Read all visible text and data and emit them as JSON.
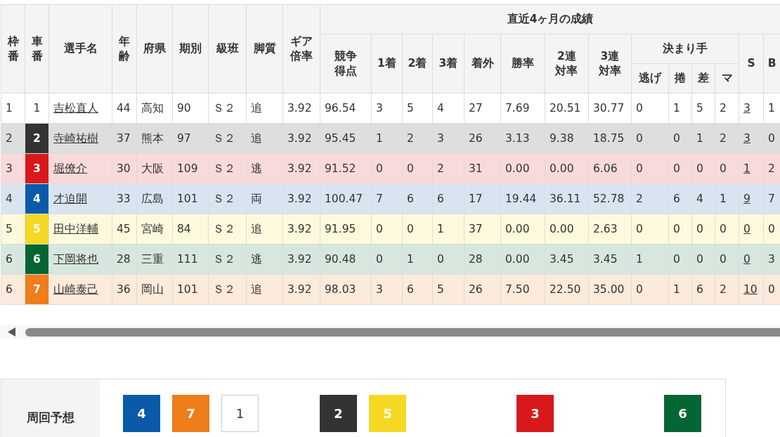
{
  "table": {
    "column_groups": [
      {
        "label": "直近4ヶ月の成績"
      },
      {
        "label": "決まり手"
      }
    ],
    "columns": [
      {
        "label": "枠番"
      },
      {
        "label": "車番"
      },
      {
        "label": "選手名"
      },
      {
        "label": "年齢"
      },
      {
        "label": "府県"
      },
      {
        "label": "期別"
      },
      {
        "label": "級班"
      },
      {
        "label": "脚質"
      },
      {
        "label": "ギア倍率"
      },
      {
        "label": "競争得点"
      },
      {
        "label": "1着"
      },
      {
        "label": "2着"
      },
      {
        "label": "3着"
      },
      {
        "label": "着外"
      },
      {
        "label": "勝率"
      },
      {
        "label": "2連対率"
      },
      {
        "label": "3連対率"
      },
      {
        "label": "逃げ"
      },
      {
        "label": "捲"
      },
      {
        "label": "差"
      },
      {
        "label": "マ"
      },
      {
        "label": "S"
      },
      {
        "label": "B"
      }
    ],
    "rows": [
      {
        "color": "#ffffff",
        "cells": [
          "1",
          "1",
          "吉松直人",
          "44",
          "高知",
          "90",
          "Ｓ２",
          "追",
          "3.92",
          "96.54",
          "3",
          "5",
          "4",
          "27",
          "7.69",
          "20.51",
          "30.77",
          "0",
          "1",
          "5",
          "2",
          "3",
          "1"
        ]
      },
      {
        "color": "#333333",
        "cells": [
          "2",
          "2",
          "寺崎祐樹",
          "37",
          "熊本",
          "97",
          "Ｓ２",
          "追",
          "3.92",
          "95.45",
          "1",
          "2",
          "3",
          "26",
          "3.13",
          "9.38",
          "18.75",
          "0",
          "0",
          "1",
          "2",
          "3",
          "0"
        ]
      },
      {
        "color": "#d9181b",
        "cells": [
          "3",
          "3",
          "堀僚介",
          "30",
          "大阪",
          "109",
          "Ｓ２",
          "逃",
          "3.92",
          "91.52",
          "0",
          "0",
          "2",
          "31",
          "0.00",
          "0.00",
          "6.06",
          "0",
          "0",
          "0",
          "0",
          "1",
          "2"
        ]
      },
      {
        "color": "#0b5aaa",
        "cells": [
          "4",
          "4",
          "才迫開",
          "33",
          "広島",
          "101",
          "Ｓ２",
          "両",
          "3.92",
          "100.47",
          "7",
          "6",
          "6",
          "17",
          "19.44",
          "36.11",
          "52.78",
          "2",
          "6",
          "4",
          "1",
          "9",
          "7"
        ]
      },
      {
        "color": "#f5d823",
        "cells": [
          "5",
          "5",
          "田中洋輔",
          "45",
          "宮崎",
          "84",
          "Ｓ２",
          "追",
          "3.92",
          "91.95",
          "0",
          "0",
          "1",
          "37",
          "0.00",
          "0.00",
          "2.63",
          "0",
          "0",
          "0",
          "0",
          "0",
          "0"
        ]
      },
      {
        "color": "#066633",
        "cells": [
          "6",
          "6",
          "下岡将也",
          "28",
          "三重",
          "111",
          "Ｓ２",
          "逃",
          "3.92",
          "90.48",
          "0",
          "1",
          "0",
          "28",
          "0.00",
          "3.45",
          "3.45",
          "1",
          "0",
          "0",
          "0",
          "0",
          "3"
        ]
      },
      {
        "color": "#ee7d1a",
        "cells": [
          "6",
          "7",
          "山崎泰己",
          "36",
          "岡山",
          "101",
          "Ｓ２",
          "追",
          "3.92",
          "98.03",
          "3",
          "6",
          "5",
          "26",
          "7.50",
          "22.50",
          "35.00",
          "0",
          "1",
          "6",
          "2",
          "10",
          "0"
        ]
      }
    ]
  },
  "lap_forecast": {
    "label": "周回予想",
    "groups": [
      [
        {
          "number": "4",
          "color": "#0b5aaa"
        },
        {
          "number": "7",
          "color": "#ee7d1a"
        },
        {
          "number": "1",
          "color": "#ffffff"
        }
      ],
      [
        {
          "number": "2",
          "color": "#333333"
        },
        {
          "number": "5",
          "color": "#f5d823"
        }
      ],
      [
        {
          "number": "3",
          "color": "#d9181b"
        }
      ],
      [
        {
          "number": "6",
          "color": "#066633"
        }
      ]
    ]
  }
}
